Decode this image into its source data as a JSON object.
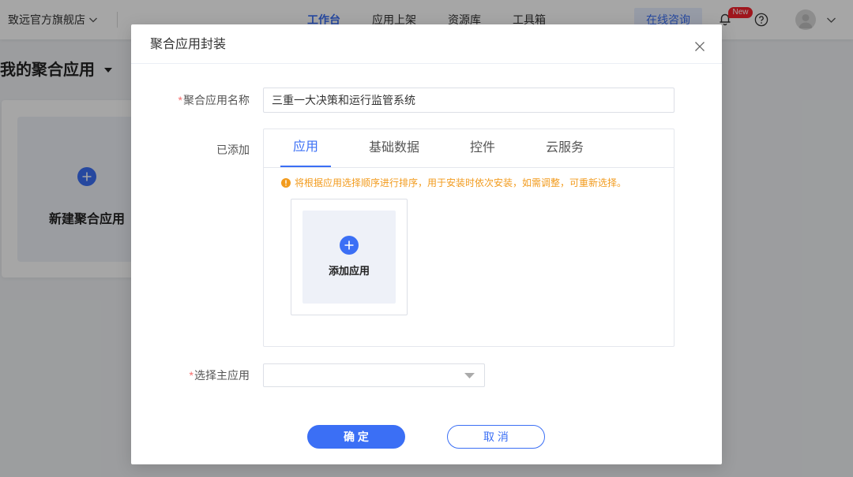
{
  "header": {
    "store_name": "致远官方旗舰店",
    "nav": [
      {
        "label": "工作台",
        "active": true
      },
      {
        "label": "应用上架",
        "active": false
      },
      {
        "label": "资源库",
        "active": false
      },
      {
        "label": "工具箱",
        "active": false
      }
    ],
    "consult_button": "在线咨询",
    "notification_badge": "New"
  },
  "page": {
    "title": "我的聚合应用",
    "new_card_label": "新建聚合应用"
  },
  "modal": {
    "title": "聚合应用封装",
    "form": {
      "required_mark": "*",
      "name": {
        "label": "聚合应用名称",
        "value": "三重一大决策和运行监管系统",
        "required": true
      },
      "added": {
        "label": "已添加",
        "tabs": [
          {
            "label": "应用",
            "active": true
          },
          {
            "label": "基础数据",
            "active": false
          },
          {
            "label": "控件",
            "active": false
          },
          {
            "label": "云服务",
            "active": false
          }
        ],
        "notice": "将根据应用选择顺序进行排序，用于安装时依次安装，如需调整，可重新选择。",
        "add_app_label": "添加应用"
      },
      "main_app": {
        "label": "选择主应用",
        "value": "",
        "required": true
      }
    },
    "buttons": {
      "confirm": "确 定",
      "cancel": "取 消"
    }
  },
  "colors": {
    "primary": "#3b6ff5",
    "warning": "#f29b1d",
    "required": "#f56c6c",
    "badge": "#f5222d",
    "overlay": "rgba(0,0,0,0.35)"
  },
  "icons": {
    "store_dropdown": "chevron-down-icon",
    "notifications": "bell-icon",
    "help": "question-circle-icon",
    "user": "avatar-icon",
    "user_menu": "chevron-down-icon",
    "title_dropdown": "caret-down-icon",
    "new_card": "plus-circle-icon",
    "close": "close-icon",
    "notice": "warning-circle-icon",
    "add_app": "plus-circle-icon",
    "select": "caret-down-icon"
  }
}
